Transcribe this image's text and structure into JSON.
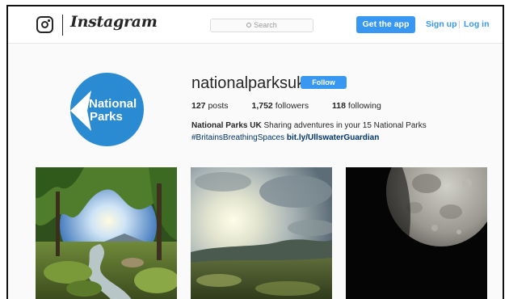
{
  "nav": {
    "brand": "Instagram",
    "search_placeholder": "Search",
    "get_app_label": "Get the app",
    "signup_label": "Sign up",
    "separator": "|",
    "login_label": "Log in"
  },
  "profile": {
    "username": "nationalparksuk",
    "follow_label": "Follow",
    "avatar_text_line1": "National",
    "avatar_text_line2": "Parks",
    "stats": {
      "posts_count": "127",
      "posts_label": "posts",
      "followers_count": "1,752",
      "followers_label": "followers",
      "following_count": "118",
      "following_label": "following"
    },
    "bio": {
      "name": "National Parks UK",
      "text": " Sharing adventures in your 15 National Parks",
      "hashtag": "#BritainsBreathingSpaces",
      "link": "bit.ly/UllswaterGuardian"
    }
  },
  "colors": {
    "accent": "#3897f0",
    "avatar_bg": "#2a8ad2",
    "link_dark": "#003569"
  },
  "posts": [
    {
      "subject": "woodland-stream-photo"
    },
    {
      "subject": "sunlit-moorland-photo"
    },
    {
      "subject": "moon-photo"
    }
  ]
}
